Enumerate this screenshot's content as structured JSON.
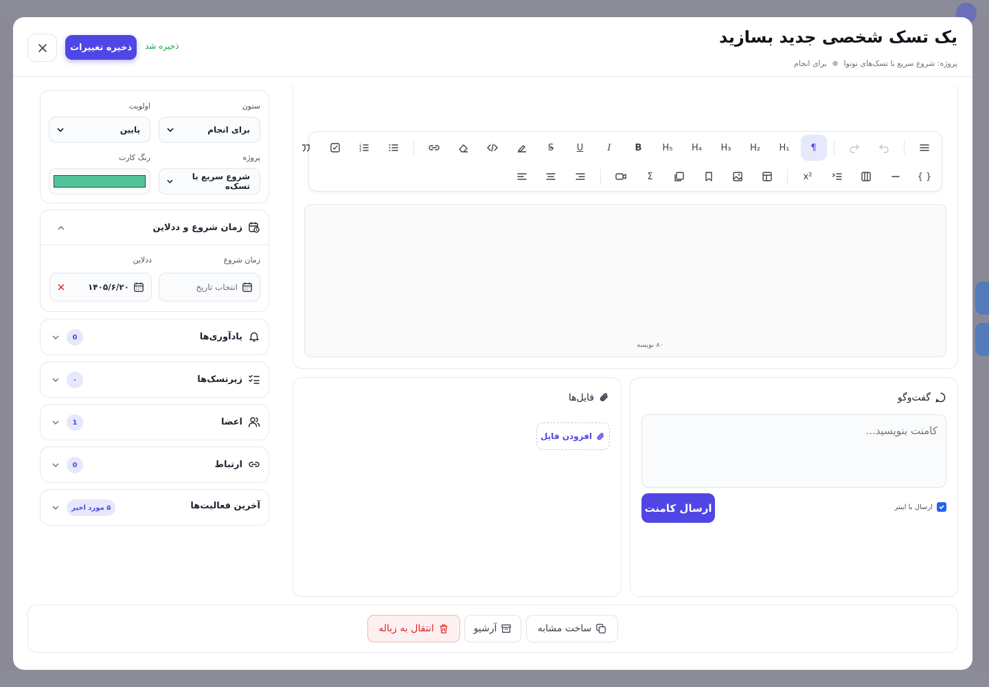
{
  "header": {
    "title": "یک تسک شخصی جدید بسازید",
    "breadcrumb_project": "پروژه: شروع سریع با تسک‌های نوتوا",
    "breadcrumb_column": "برای انجام",
    "save_label": "ذخیره تغییرات",
    "saved_status": "ذخیره شد"
  },
  "meta": {
    "column_label": "ستون",
    "column_value": "برای انجام",
    "priority_label": "اولویت",
    "priority_value": "پایین",
    "project_label": "پروژه",
    "project_value": "شروع سریع با تسک‌ه",
    "card_color_label": "رنگ کارت",
    "card_color": "#52c49a"
  },
  "dates": {
    "title": "زمان شروع و ددلاین",
    "start_label": "زمان شروع",
    "start_placeholder": "انتخاب تاریخ",
    "deadline_label": "ددلاین",
    "deadline_value": "۱۴۰۵/۶/۲۰"
  },
  "accordions": {
    "reminders": {
      "title": "یادآوری‌ها",
      "count": "0"
    },
    "subtasks": {
      "title": "زیرتسک‌ها",
      "count": "۰"
    },
    "members": {
      "title": "اعضا",
      "count": "1"
    },
    "links": {
      "title": "ارتباط",
      "count": "0"
    },
    "activity": {
      "title": "آخرین فعالیت‌ها",
      "count": "۵ مورد اخیر"
    }
  },
  "editor": {
    "char_count": "۸۰ نویسه",
    "toolbar_row1": [
      "menu-icon",
      "undo-icon",
      "redo-icon",
      "paragraph-icon",
      "H1",
      "H2",
      "H3",
      "H4",
      "H5",
      "bold-icon",
      "italic-icon",
      "underline-icon",
      "strikethrough-icon",
      "highlight-icon",
      "code-icon",
      "eraser-icon",
      "link-icon",
      "bullet-list-icon",
      "ordered-list-icon",
      "task-list-icon",
      "quote-icon"
    ],
    "toolbar_row2": [
      "code-block-icon",
      "horizontal-rule-icon",
      "columns-icon",
      "indent-list-icon",
      "superscript-icon",
      "table-icon",
      "image-icon",
      "bookmark-icon",
      "gallery-icon",
      "sigma-icon",
      "video-icon",
      "align-right-icon",
      "align-center-icon",
      "align-left-icon"
    ]
  },
  "chat": {
    "title": "گفت‌وگو",
    "placeholder": "کامنت بنویسید...",
    "send_label": "ارسال کامنت",
    "send_on_enter_label": "ارسال با اینتر",
    "send_on_enter": true
  },
  "files": {
    "title": "فایل‌ها",
    "add_label": "افزودن فایل"
  },
  "footer": {
    "duplicate_label": "ساخت مشابه",
    "archive_label": "آرشیو",
    "trash_label": "انتقال به زباله"
  },
  "colors": {
    "accent": "#4f46e5",
    "danger": "#dc2626",
    "success": "#16a34a"
  }
}
